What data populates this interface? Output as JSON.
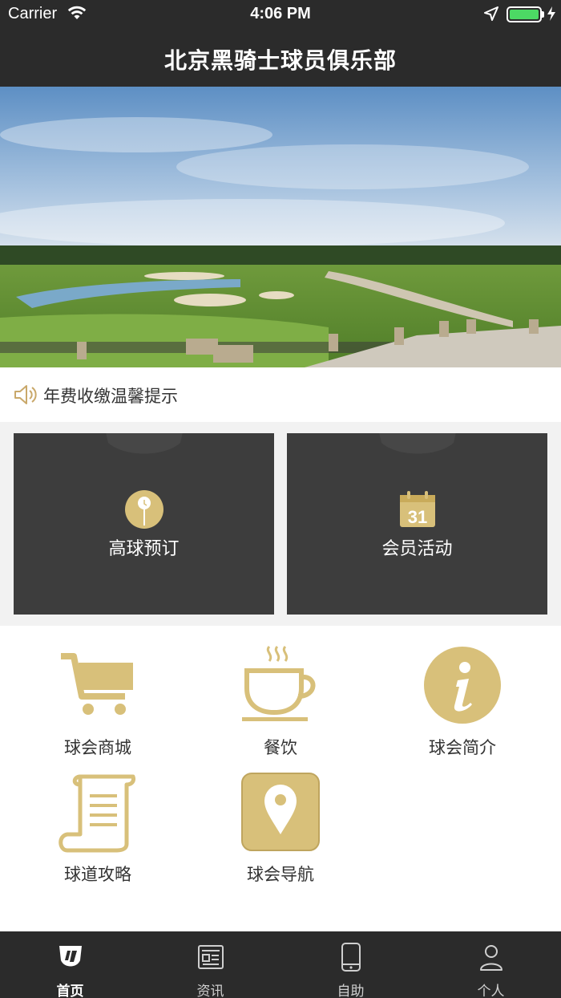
{
  "status_bar": {
    "carrier": "Carrier",
    "time": "4:06 PM",
    "battery_color": "#4cd964"
  },
  "header": {
    "title": "北京黑骑士球员俱乐部"
  },
  "banner": {
    "image": "golf-course-landscape",
    "carousel": {
      "total": 3,
      "active_index": 0
    }
  },
  "notice": {
    "icon": "speaker-icon",
    "text": "年费收缴温馨提示"
  },
  "cards": [
    {
      "label": "高球预订",
      "icon": "golf-pin-icon"
    },
    {
      "label": "会员活动",
      "icon": "calendar-icon",
      "icon_text": "31"
    }
  ],
  "grid": [
    {
      "label": "球会商城",
      "icon": "cart-icon"
    },
    {
      "label": "餐饮",
      "icon": "coffee-cup-icon"
    },
    {
      "label": "球会简介",
      "icon": "info-icon"
    },
    {
      "label": "球道攻略",
      "icon": "scroll-icon"
    },
    {
      "label": "球会导航",
      "icon": "map-pin-icon"
    }
  ],
  "tab_bar": {
    "active": "首页",
    "items": [
      {
        "label": "首页",
        "icon": "home-logo-icon"
      },
      {
        "label": "资讯",
        "icon": "news-icon"
      },
      {
        "label": "自助",
        "icon": "phone-icon"
      },
      {
        "label": "个人",
        "icon": "person-icon"
      }
    ]
  },
  "colors": {
    "dark_bar": "#2b2b2b",
    "card_bg": "#3d3d3d",
    "accent_gold": "#d8c07a",
    "page_bg": "#f2f2f2"
  }
}
